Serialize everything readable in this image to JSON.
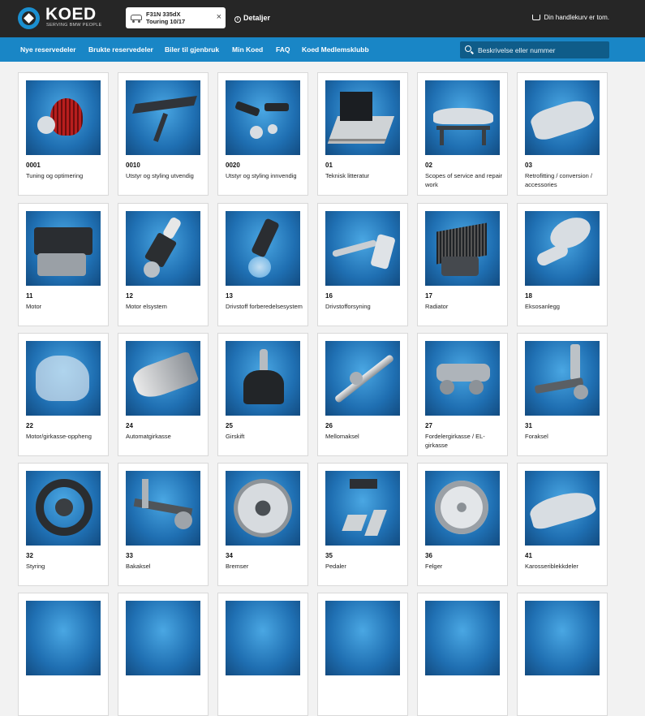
{
  "header": {
    "logo_text": "KOED",
    "logo_tagline": "SERVING BMW PEOPLE",
    "vehicle_line1": "F31N 335dX",
    "vehicle_line2": "Touring 10/17",
    "vehicle_close": "×",
    "details_label": "Detaljer",
    "cart_label": "Din handlekurv er tom."
  },
  "nav": {
    "items": [
      "Nye reservedeler",
      "Brukte reservedeler",
      "Biler til gjenbruk",
      "Min Koed",
      "FAQ",
      "Koed Medlemsklubb"
    ],
    "search_placeholder": "Beskrivelse eller nummer"
  },
  "categories": [
    {
      "code": "0001",
      "name": "Tuning og optimering",
      "icon": "air-filter-icon"
    },
    {
      "code": "0010",
      "name": "Utstyr og styling utvendig",
      "icon": "spoiler-icon"
    },
    {
      "code": "0020",
      "name": "Utstyr og styling innvendig",
      "icon": "interior-parts-icon"
    },
    {
      "code": "01",
      "name": "Teknisk litteratur",
      "icon": "books-icon"
    },
    {
      "code": "02",
      "name": "Scopes of service and repair work",
      "icon": "car-lift-icon"
    },
    {
      "code": "03",
      "name": "Retrofitting / conversion / accessories",
      "icon": "car-icon"
    },
    {
      "code": "11",
      "name": "Motor",
      "icon": "engine-icon"
    },
    {
      "code": "12",
      "name": "Motor elsystem",
      "icon": "spark-plug-icon"
    },
    {
      "code": "13",
      "name": "Drivstoff forberedelsesystem",
      "icon": "injector-icon"
    },
    {
      "code": "16",
      "name": "Drivstofforsyning",
      "icon": "fuel-nozzle-icon"
    },
    {
      "code": "17",
      "name": "Radiator",
      "icon": "radiator-icon"
    },
    {
      "code": "18",
      "name": "Eksosanlegg",
      "icon": "exhaust-icon"
    },
    {
      "code": "22",
      "name": "Motor/girkasse-oppheng",
      "icon": "mount-icon"
    },
    {
      "code": "24",
      "name": "Automatgirkasse",
      "icon": "gearbox-icon"
    },
    {
      "code": "25",
      "name": "Girskift",
      "icon": "gear-shift-icon"
    },
    {
      "code": "26",
      "name": "Mellomaksel",
      "icon": "drive-shaft-icon"
    },
    {
      "code": "27",
      "name": "Fordelergirkasse / EL-girkasse",
      "icon": "transfer-case-icon"
    },
    {
      "code": "31",
      "name": "Foraksel",
      "icon": "front-axle-icon"
    },
    {
      "code": "32",
      "name": "Styring",
      "icon": "steering-wheel-icon"
    },
    {
      "code": "33",
      "name": "Bakaksel",
      "icon": "rear-axle-icon"
    },
    {
      "code": "34",
      "name": "Bremser",
      "icon": "brake-disc-icon"
    },
    {
      "code": "35",
      "name": "Pedaler",
      "icon": "pedals-icon"
    },
    {
      "code": "36",
      "name": "Felger",
      "icon": "rim-icon"
    },
    {
      "code": "41",
      "name": "Karosseriblekkdeler",
      "icon": "body-shell-icon"
    }
  ],
  "colors": {
    "topbar": "#262626",
    "navbar": "#1986c6",
    "search_bg": "#0f5c89",
    "thumb_blue": "#2a82c8"
  }
}
